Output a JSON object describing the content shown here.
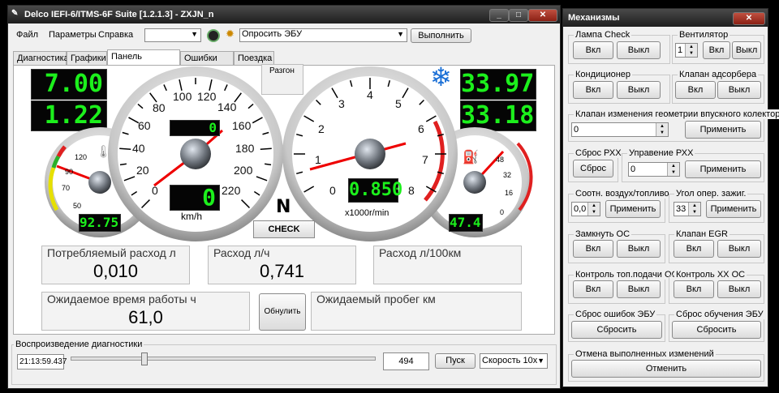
{
  "main_window": {
    "title": "Delco IEFI-6/ITMS-6F Suite [1.2.1.3] - ZXJN_n",
    "menu": [
      "Файл",
      "Параметры",
      "Справка"
    ],
    "toolbar": {
      "select_value": "",
      "command_value": "Опросить ЭБУ",
      "execute_label": "Выполнить"
    },
    "tabs": [
      "Диагностика",
      "Графики",
      "Панель приборов",
      "Ошибки ЭБУ",
      "Поездка"
    ],
    "active_tab": "Панель приборов"
  },
  "dashboard": {
    "razgon_label": "Разгон",
    "left_lcd_top": "7.00",
    "left_lcd_bottom": "1.22",
    "right_lcd_top": "33.97",
    "right_lcd_bottom": "33.18",
    "speedometer": {
      "ticks": [
        "0",
        "20",
        "40",
        "60",
        "80",
        "100",
        "120",
        "140",
        "160",
        "180",
        "200",
        "220"
      ],
      "odometer": "0",
      "speed_value": "0",
      "unit": "km/h"
    },
    "tachometer": {
      "ticks": [
        "0",
        "1",
        "2",
        "3",
        "4",
        "5",
        "6",
        "7",
        "8"
      ],
      "value": "0.850",
      "unit": "x1000r/min"
    },
    "temp_gauge": {
      "ticks": [
        "50",
        "70",
        "90",
        "120"
      ],
      "value": "92.75"
    },
    "fuel_gauge": {
      "ticks": [
        "0",
        "16",
        "32",
        "48"
      ],
      "value": "47.4"
    },
    "gear": "N",
    "check_label": "CHECK",
    "consumption_label": "Потребляемый расход л",
    "consumption_value": "0,010",
    "rate_label": "Расход л/ч",
    "rate_value": "0,741",
    "per100_label": "Расход л/100км",
    "per100_value": "",
    "runtime_label": "Ожидаемое время работы ч",
    "runtime_value": "61,0",
    "reset_label": "Обнулить",
    "range_label": "Ожидаемый пробег км",
    "range_value": ""
  },
  "playback": {
    "label": "Воспроизведение диагностики",
    "time": "21:13:59.437",
    "position_fraction": 0.24,
    "frame": "494",
    "start_label": "Пуск",
    "speed_value": "Скорость 10х"
  },
  "mechanisms": {
    "title": "Механизмы",
    "on": "Вкл",
    "off": "Выкл",
    "apply": "Применить",
    "check_lamp": "Лампа Check",
    "fan": "Вентилятор",
    "fan_value": "1",
    "ac": "Кондиционер",
    "adsorber": "Клапан адсорбера",
    "geometry": "Клапан изменения геометрии впускного колектора",
    "geometry_value": "0",
    "reset_rxx": "Сброс РХХ",
    "reset_label": "Сброс",
    "rxx_control": "Управение РХХ",
    "rxx_value": "0",
    "air_fuel": "Соотн. воздух/топливо",
    "air_fuel_value": "0,0",
    "ignition_angle": "Угол опер. зажиг.",
    "ignition_value": "33",
    "close_os": "Замкнуть ОС",
    "egr": "Клапан EGR",
    "fuel_os": "Контроль топ.подачи ОС",
    "idle_os": "Контроль ХХ ОС",
    "reset_errors": "Сброс ошибок ЭБУ",
    "reset_learning": "Сброс обучения ЭБУ",
    "reset_btn": "Сбросить",
    "undo": "Отмена выполненных изменений",
    "cancel": "Отменить"
  }
}
